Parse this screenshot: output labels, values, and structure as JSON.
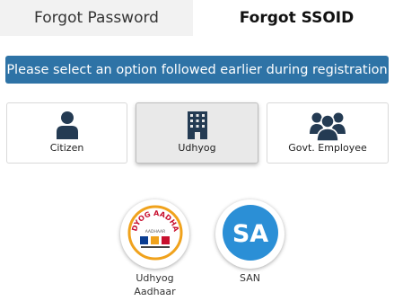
{
  "tabs": {
    "forgot_password": "Forgot Password",
    "forgot_ssoid": "Forgot SSOID"
  },
  "banner": {
    "text": "Please select an option followed earlier during registration"
  },
  "options": [
    {
      "label": "Citizen",
      "icon": "person-icon"
    },
    {
      "label": "Udhyog",
      "icon": "building-icon"
    },
    {
      "label": "Govt. Employee",
      "icon": "group-icon"
    }
  ],
  "sub_options": [
    {
      "label_line1": "Udhyog",
      "label_line2": "Aadhaar",
      "logo_text": "UDYOG AADHAR",
      "logo_subtext": "AADHAAR"
    },
    {
      "label": "SAN",
      "logo_text": "SA"
    }
  ],
  "colors": {
    "banner_bg": "#2e73a6",
    "icon_dark": "#243b53",
    "san_blue": "#2b8fd6"
  }
}
